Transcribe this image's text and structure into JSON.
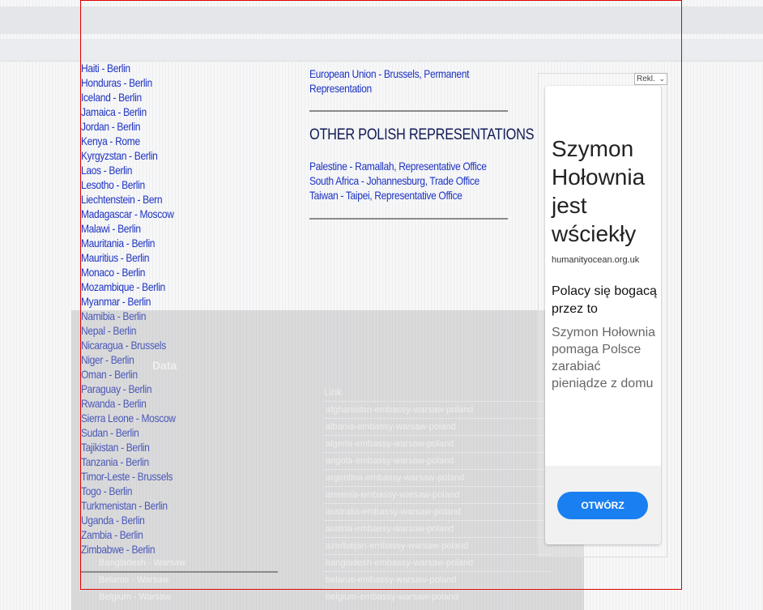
{
  "countries": [
    "Haiti - Berlin",
    "Honduras - Berlin",
    "Iceland - Berlin",
    "Jamaica - Berlin",
    "Jordan - Berlin",
    "Kenya - Rome",
    "Kyrgyzstan - Berlin",
    "Laos - Berlin",
    "Lesotho - Berlin",
    "Liechtenstein - Bern",
    "Madagascar - Moscow",
    "Malawi - Berlin",
    "Mauritania - Berlin",
    "Mauritius - Berlin",
    "Monaco - Berlin",
    "Mozambique - Berlin",
    "Myanmar - Berlin",
    "Namibia - Berlin",
    "Nepal - Berlin",
    "Nicaragua - Brussels",
    "Niger - Berlin",
    "Oman - Berlin",
    "Paraguay - Berlin",
    "Rwanda - Berlin",
    "Sierra Leone - Moscow",
    "Sudan - Berlin",
    "Tajikistan - Berlin",
    "Tanzania - Berlin",
    "Timor-Leste - Brussels",
    "Togo - Berlin",
    "Turkmenistan - Berlin",
    "Uganda - Berlin",
    "Zambia - Berlin",
    "Zimbabwe - Berlin"
  ],
  "right": {
    "eu_link": "European Union - Brussels, Permanent Representation",
    "section_title": "OTHER POLISH REPRESENTATIONS",
    "other_links": [
      "Palestine - Ramallah, Representative Office",
      "South Africa - Johannesburg, Trade Office",
      "Taiwan - Taipei, Representative Office"
    ]
  },
  "overlay": {
    "close": "×",
    "title": "Data",
    "link_header": "Link",
    "links": [
      "afghanistan-embassy-warsaw-poland",
      "albania-embassy-warsaw-poland",
      "algeria-embassy-warsaw-poland",
      "angola-embassy-warsaw-poland",
      "argentina-embassy-warsaw-poland",
      "armenia-embassy-warsaw-poland",
      "australia-embassy-warsaw-poland",
      "austria-embassy-warsaw-poland",
      "azerbaijan-embassy-warsaw-poland",
      "bangladesh-embassy-warsaw-poland",
      "belarus-embassy-warsaw-poland",
      "belgium-embassy-warsaw-poland"
    ],
    "left_rows": [
      "Bangladesh - Warsaw",
      "Belarus - Warsaw",
      "Belgium - Warsaw"
    ]
  },
  "ad": {
    "tag": "Rekl.",
    "headline": "Szymon Hołownia jest wściekły",
    "domain": "humanityocean.org.uk",
    "subhead": "Polacy się bogacą przez to",
    "description": "Szymon Hołownia pomaga Polsce zarabiać pieniądze z domu",
    "cta": "OTWÓRZ",
    "cta_color": "#1a7ff0"
  }
}
